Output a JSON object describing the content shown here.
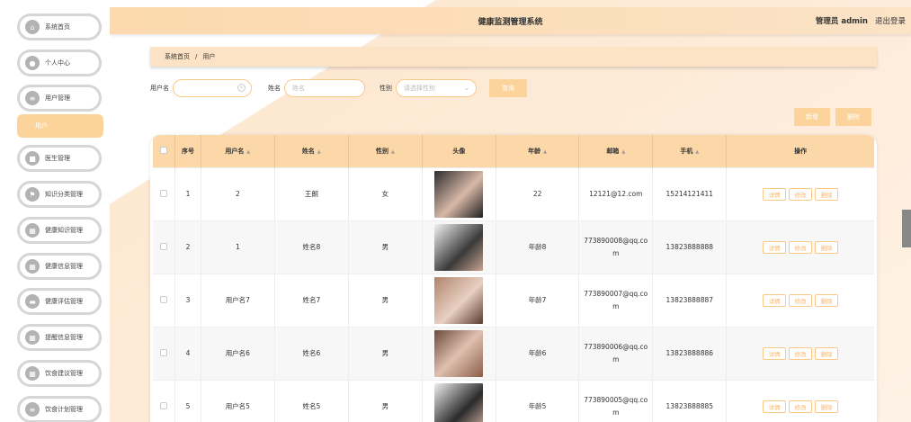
{
  "sidebar": {
    "items": [
      {
        "label": "系统首页",
        "icon": "home-icon"
      },
      {
        "label": "个人中心",
        "icon": "user-icon"
      },
      {
        "label": "用户管理",
        "icon": "list-icon"
      },
      {
        "label": "医生管理",
        "icon": "doctor-icon"
      },
      {
        "label": "知识分类管理",
        "icon": "flag-icon"
      },
      {
        "label": "健康知识管理",
        "icon": "grid-icon"
      },
      {
        "label": "健康信息管理",
        "icon": "grid-icon"
      },
      {
        "label": "健康评估管理",
        "icon": "chat-icon"
      },
      {
        "label": "提醒信息管理",
        "icon": "grid-icon"
      },
      {
        "label": "饮食建议管理",
        "icon": "grid-icon"
      },
      {
        "label": "饮食计划管理",
        "icon": "list-icon"
      }
    ],
    "sub_item": "用户"
  },
  "header": {
    "title": "健康监测管理系统",
    "admin": "管理员 admin",
    "logout": "退出登录"
  },
  "breadcrumb": {
    "home": "系统首页",
    "sep": "/",
    "current": "用户"
  },
  "search": {
    "username_label": "用户名",
    "username_value": "",
    "name_label": "姓名",
    "name_placeholder": "姓名",
    "gender_label": "性别",
    "gender_placeholder": "请选择性别",
    "query_button": "查询"
  },
  "actions": {
    "add": "新增",
    "delete": "删除"
  },
  "table": {
    "headers": [
      "序号",
      "用户名",
      "姓名",
      "性别",
      "头像",
      "年龄",
      "邮箱",
      "手机",
      "操作"
    ],
    "rows": [
      {
        "no": "1",
        "username": "2",
        "name": "王朗",
        "gender": "女",
        "age": "22",
        "email": "12121@12.com",
        "phone": "15214121411"
      },
      {
        "no": "2",
        "username": "1",
        "name": "姓名8",
        "gender": "男",
        "age": "年龄8",
        "email": "773890008@qq.co\nm",
        "phone": "13823888888"
      },
      {
        "no": "3",
        "username": "用户名7",
        "name": "姓名7",
        "gender": "男",
        "age": "年龄7",
        "email": "773890007@qq.co\nm",
        "phone": "13823888887"
      },
      {
        "no": "4",
        "username": "用户名6",
        "name": "姓名6",
        "gender": "男",
        "age": "年龄6",
        "email": "773890006@qq.co\nm",
        "phone": "13823888886"
      },
      {
        "no": "5",
        "username": "用户名5",
        "name": "姓名5",
        "gender": "男",
        "age": "年龄5",
        "email": "773890005@qq.co\nm",
        "phone": "13823888885"
      }
    ],
    "ops": {
      "detail": "详情",
      "edit": "修改",
      "delete": "删除"
    }
  },
  "colors": {
    "accent": "#fbd39b",
    "header": "#fcd9ae",
    "border": "#fcc888"
  }
}
